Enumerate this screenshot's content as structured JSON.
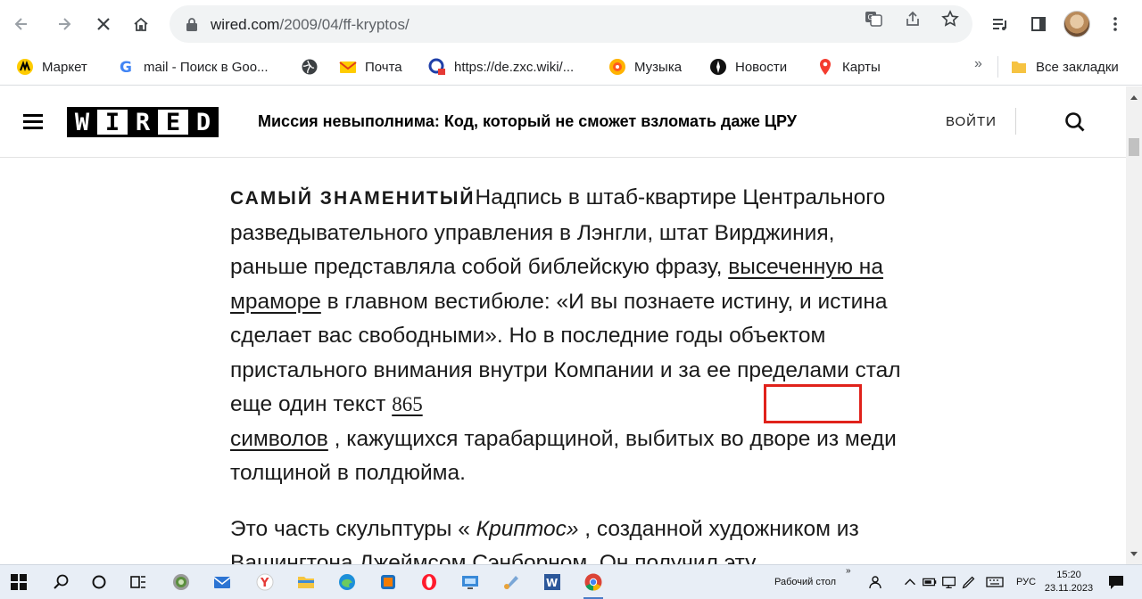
{
  "browser": {
    "url_host": "wired.com",
    "url_path": "/2009/04/ff-kryptos/",
    "bookmarks": [
      {
        "label": "Маркет",
        "icon": "yandex-market-icon"
      },
      {
        "label": "mail - Поиск в Goo...",
        "icon": "google-icon"
      },
      {
        "label": "",
        "icon": "globe-icon"
      },
      {
        "label": "Почта",
        "icon": "mail-icon"
      },
      {
        "label": "https://de.zxc.wiki/...",
        "icon": "wiki-icon"
      },
      {
        "label": "Музыка",
        "icon": "music-icon"
      },
      {
        "label": "Новости",
        "icon": "news-icon"
      },
      {
        "label": "Карты",
        "icon": "maps-pin-icon"
      }
    ],
    "bookmarks_more": "»",
    "all_bookmarks": "Все закладки"
  },
  "site": {
    "header_title": "Миссия невыполнима: Код, который не сможет взломать даже ЦРУ",
    "login_label": "ВОЙТИ",
    "logo_letters": [
      "W",
      "I",
      "R",
      "E",
      "D"
    ]
  },
  "article": {
    "lead": "САМЫЙ ЗНАМЕНИТЫЙ",
    "p1_text_a": "Надпись в штаб-квартире Центрального разведывательного управления в Лэнгли, штат Вирджиния, раньше представляла собой библейскую фразу, ",
    "p1_link1": "высеченную на мраморе",
    "p1_text_b": " в главном вестибюле: «И вы познаете истину, и истина сделает вас свободными». Но в последние годы объектом пристального внимания внутри Компании и за ее пределами стал еще один текст ",
    "p1_link2_num": "865",
    "p1_link2_word": "символов",
    "p1_text_c": " , кажущихся тарабарщиной, выбитых во дворе из меди толщиной в полдюйма.",
    "p2_text_a": "Это часть скульптуры « ",
    "p2_italic": "Криптос»",
    "p2_text_b": " , созданной художником из Вашингтона Джеймсом Сэнборном. Он получил эту"
  },
  "taskbar": {
    "desktop_label": "Рабочий стол",
    "lang": "РУС",
    "time": "15:20",
    "date": "23.11.2023"
  },
  "colors": {
    "highlight": "#e0221b",
    "taskbar_bg": "#e8eef6"
  }
}
